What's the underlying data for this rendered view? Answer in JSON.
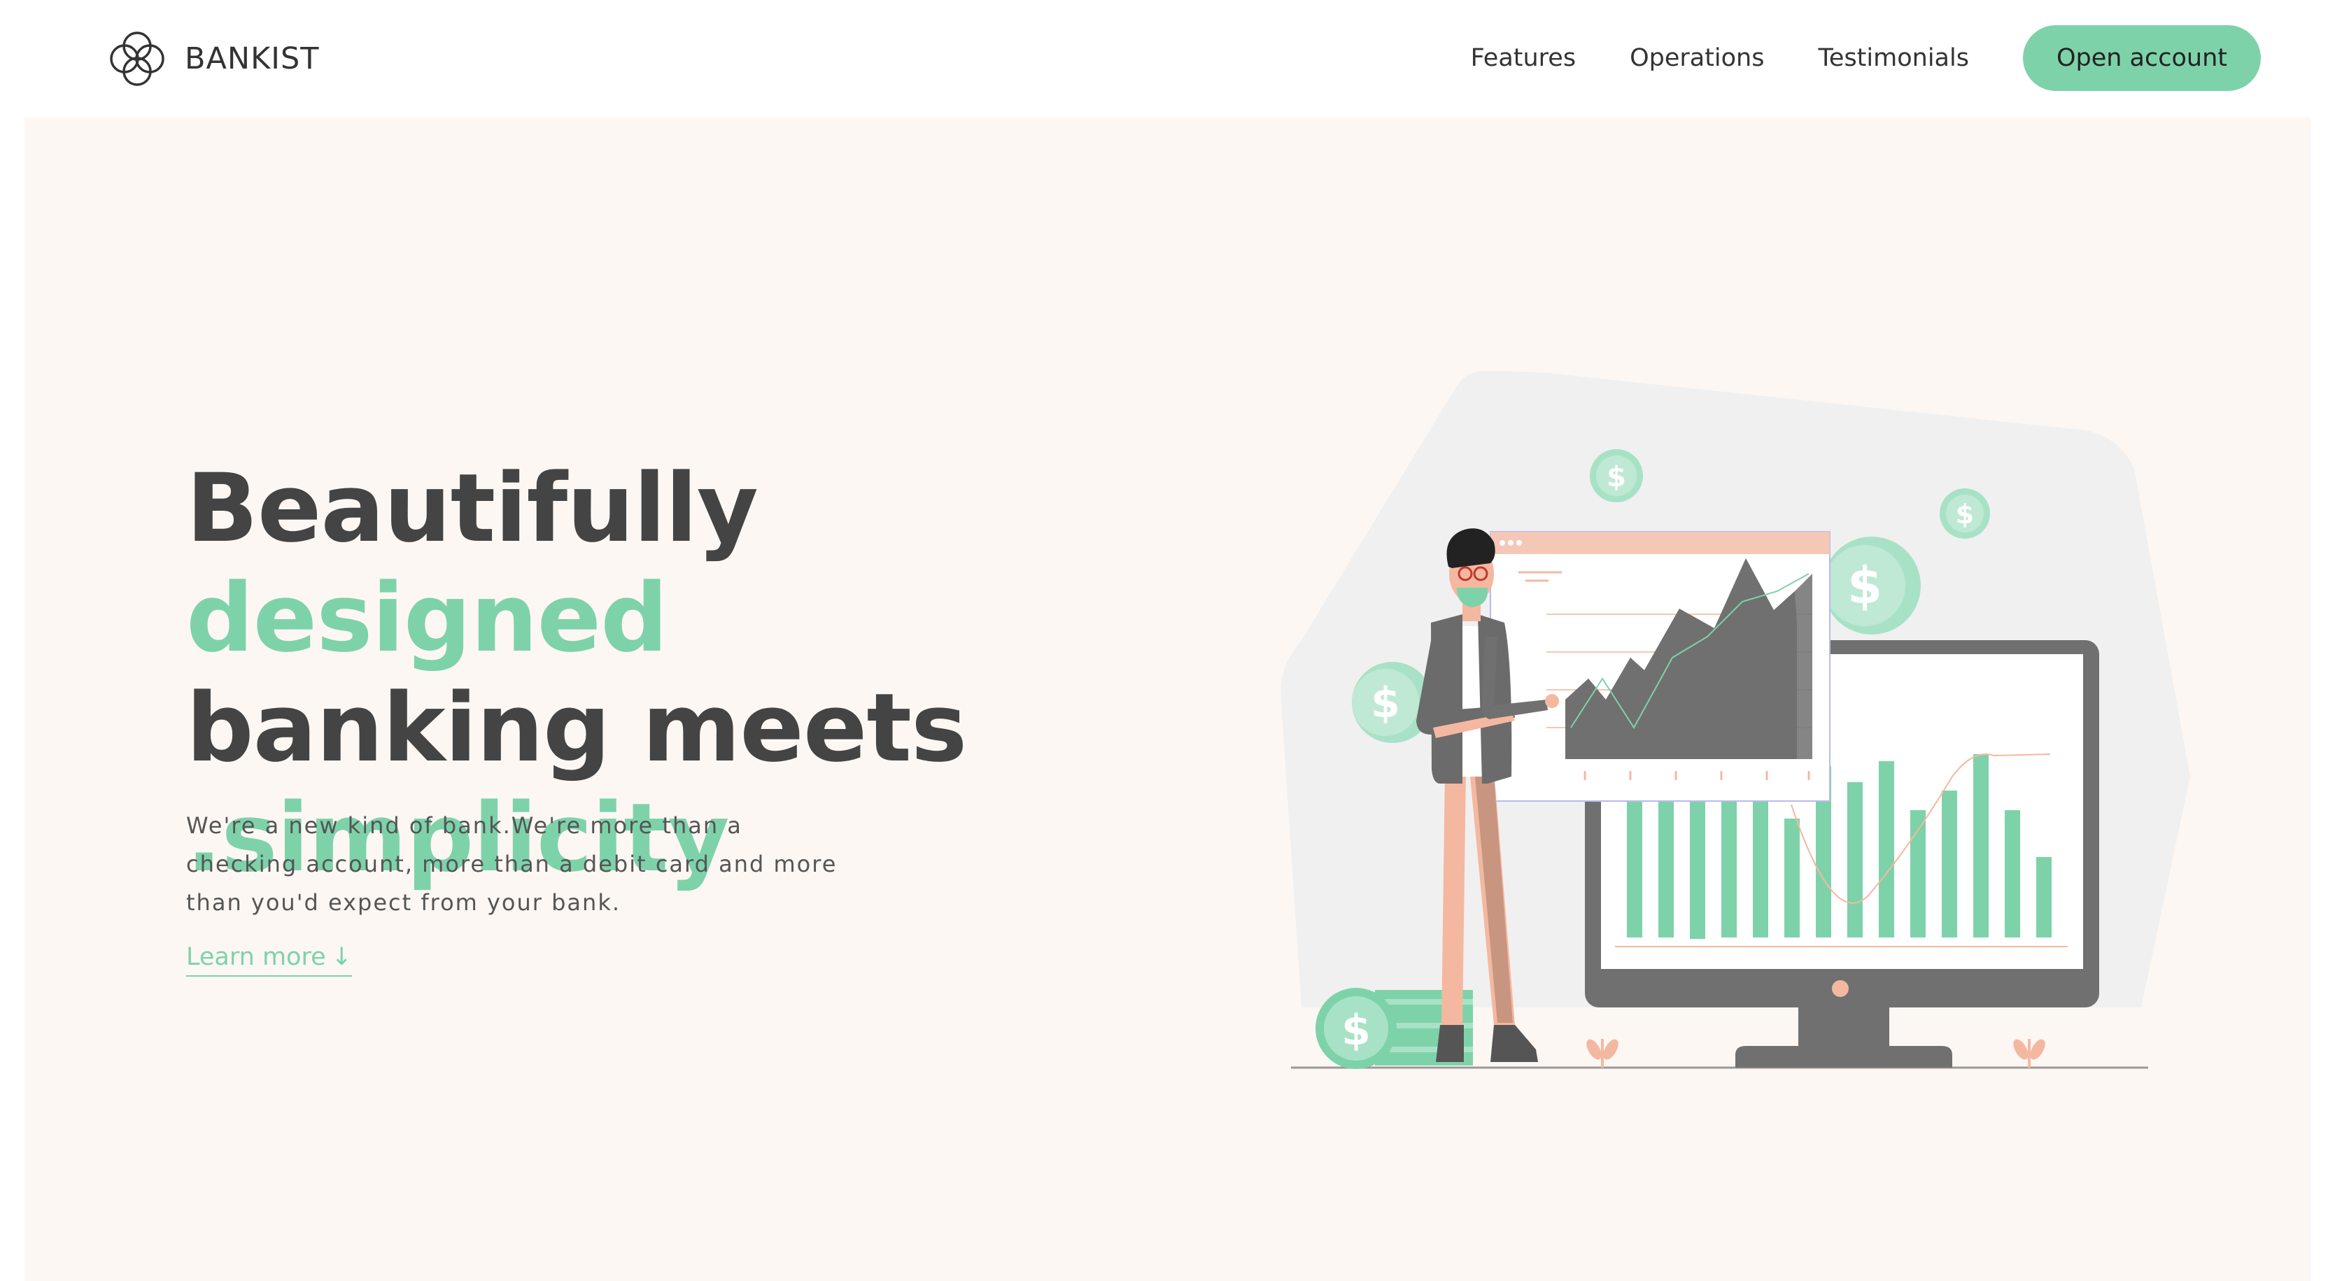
{
  "nav": {
    "brand": "BANKIST",
    "logo_icon": "four-circle-flower-logo",
    "links": [
      "Features",
      "Operations",
      "Testimonials"
    ],
    "cta": "Open account"
  },
  "hero": {
    "title_part1": "Beautifully",
    "title_highlight1": "designed",
    "title_part2": "banking meets",
    "title_highlight2": ".simplicity",
    "subtitle": "We're a new kind of bank.We're more than a checking account, more than a debit card and more than you'd expect from your bank.",
    "learn_more": "Learn more",
    "learn_more_icon": "arrow-down-icon",
    "learn_more_arrow": "↓",
    "illustration": "man-presenting-financial-charts"
  },
  "colors": {
    "accent": "#7ed2aa",
    "hero_background": "#fcf7f3",
    "text_dark": "#444444",
    "chart_gray": "#707070",
    "salmon": "#f4b8a0"
  }
}
